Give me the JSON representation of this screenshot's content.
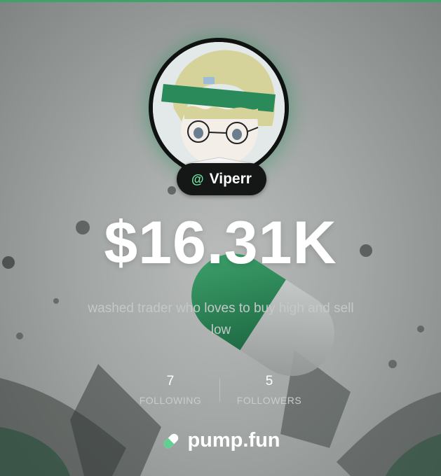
{
  "profile": {
    "handle_prefix": "@",
    "handle": "Viperr",
    "value": "$16.31K",
    "bio": "washed trader who loves to buy high and sell low"
  },
  "stats": {
    "following_count": "7",
    "following_label": "FOLLOWING",
    "followers_count": "5",
    "followers_label": "FOLLOWERS"
  },
  "brand": {
    "name": "pump.fun",
    "logo_icon": "pill-icon"
  },
  "colors": {
    "accent_green": "#3ea36a",
    "pill_green": "#2f8a5a",
    "text_white": "#ffffff"
  }
}
